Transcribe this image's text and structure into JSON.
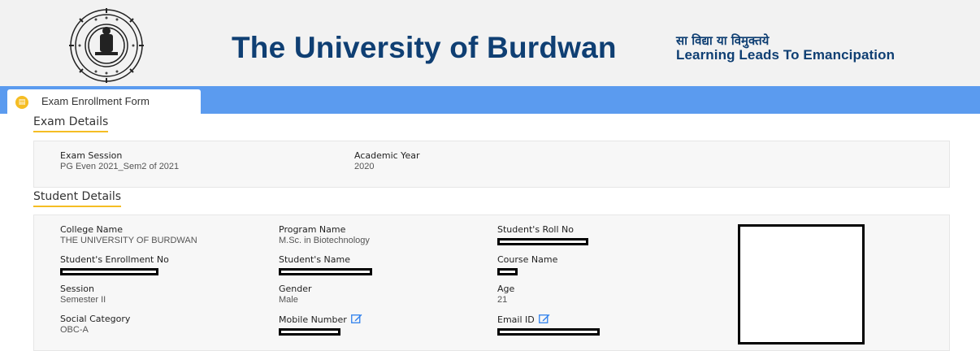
{
  "header": {
    "university_name": "The University of Burdwan",
    "motto_hindi": "सा विद्या या विमुक्तये",
    "motto_english": "Learning Leads To Emancipation",
    "logo_icon": "university-seal-logo",
    "title_color": "#0f3f73"
  },
  "tabs": [
    {
      "label": "Exam Enrollment Form",
      "icon": "form-icon"
    }
  ],
  "exam_details": {
    "section_title": "Exam Details",
    "exam_session_label": "Exam Session",
    "exam_session_value": "PG Even 2021_Sem2 of 2021",
    "academic_year_label": "Academic Year",
    "academic_year_value": "2020"
  },
  "student_details": {
    "section_title": "Student Details",
    "college_name_label": "College Name",
    "college_name_value": "THE UNIVERSITY OF BURDWAN",
    "program_name_label": "Program Name",
    "program_name_value": "M.Sc. in Biotechnology",
    "roll_no_label": "Student's Roll No",
    "enrollment_no_label": "Student's Enrollment No",
    "student_name_label": "Student's Name",
    "course_name_label": "Course Name",
    "session_label": "Session",
    "session_value": "Semester II",
    "gender_label": "Gender",
    "gender_value": "Male",
    "age_label": "Age",
    "age_value": "21",
    "social_category_label": "Social Category",
    "social_category_value": "OBC-A",
    "mobile_label": "Mobile Number",
    "email_label": "Email ID"
  },
  "colors": {
    "tab_bar": "#5b9bef",
    "accent_underline": "#f5bd24",
    "edit_icon": "#2f80ed"
  }
}
